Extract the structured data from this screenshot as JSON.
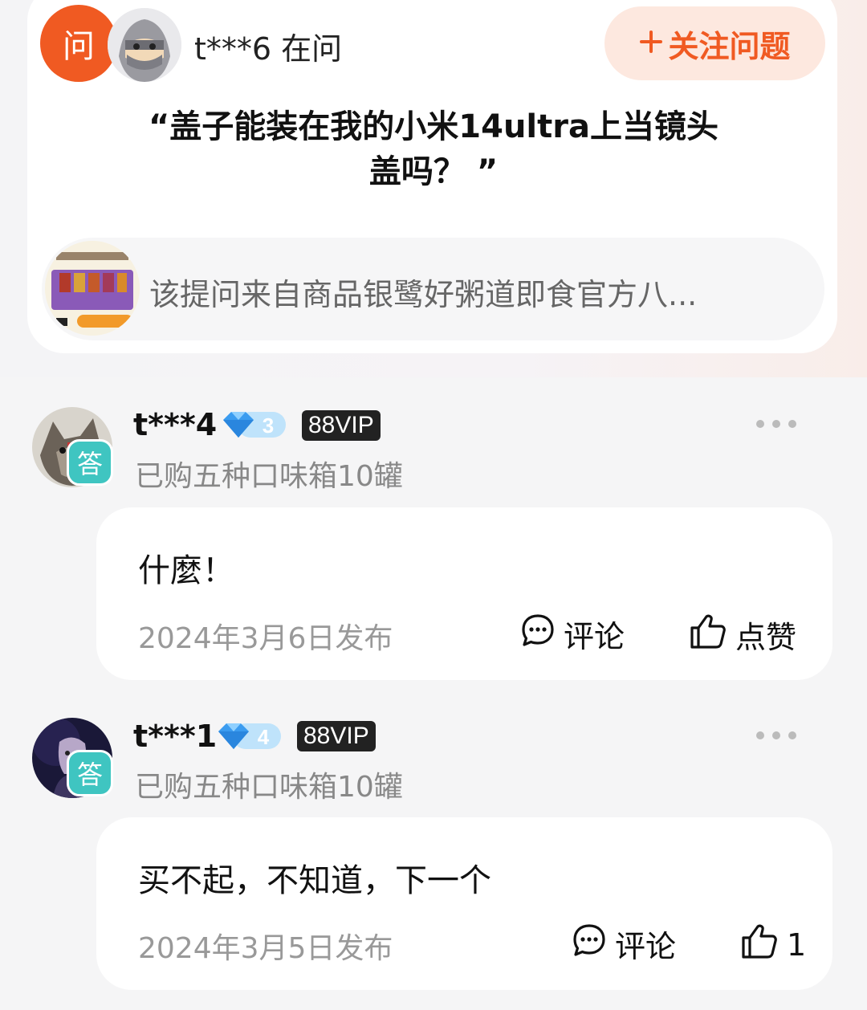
{
  "question": {
    "badge": "问",
    "asker": "t***6 在问",
    "follow_label": "关注问题",
    "follow_icon": "plus-icon",
    "title_line1": "“盖子能装在我的小米14ultra上当镜头",
    "title_line2": "盖吗？ ”",
    "source_text": "该提问来自商品银鹭好粥道即食官方八..."
  },
  "answers": [
    {
      "name": "t***4",
      "level": "3",
      "vip": "88VIP",
      "badge": "答",
      "purchase": "已购五种口味箱10罐",
      "text": "什麼！",
      "date": "2024年3月6日发布",
      "comment_label": "评论",
      "like_label": "点赞"
    },
    {
      "name": "t***1",
      "level": "4",
      "vip": "88VIP",
      "badge": "答",
      "purchase": "已购五种口味箱10罐",
      "text": "买不起，不知道，下一个",
      "date": "2024年3月5日发布",
      "comment_label": "评论",
      "like_label": "1"
    }
  ],
  "colors": {
    "accent": "#f05a22",
    "answer_badge": "#3fc5c1",
    "follow_bg": "#fde8df"
  }
}
